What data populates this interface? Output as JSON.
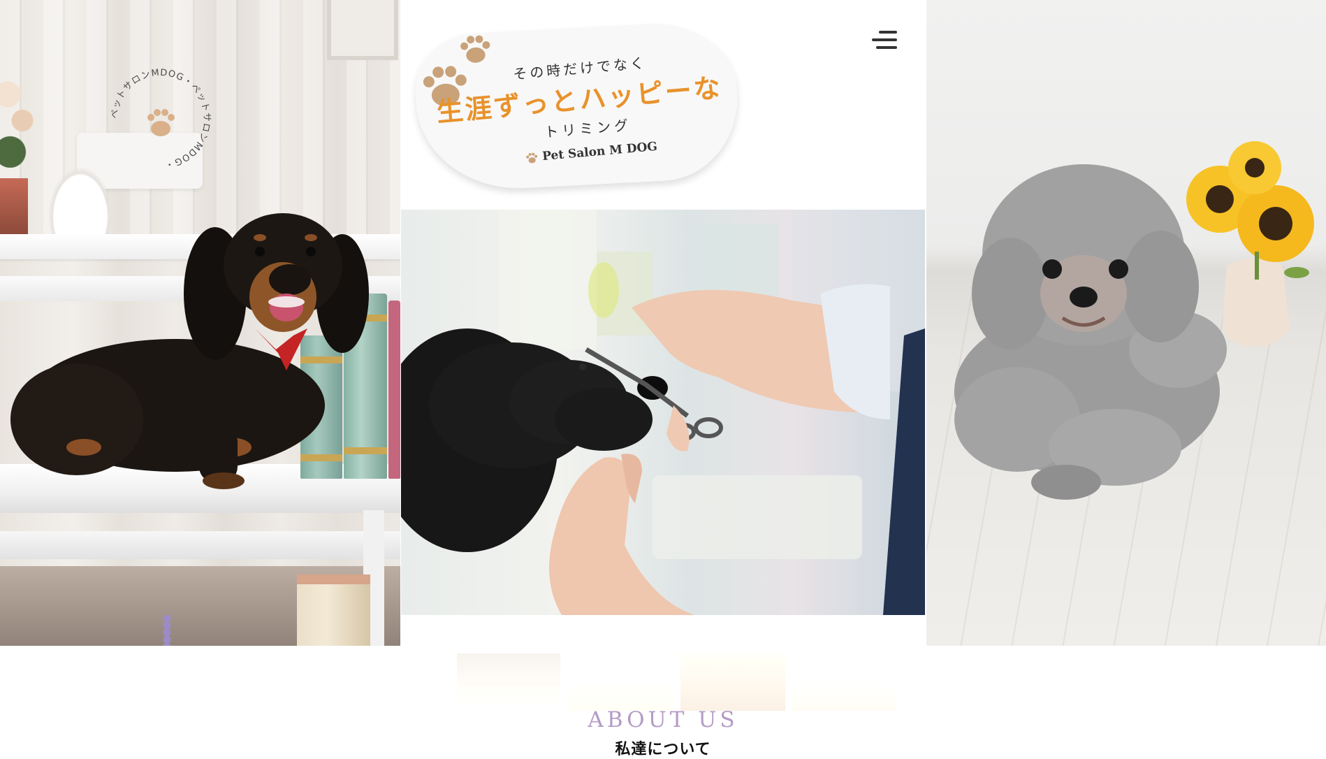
{
  "logo": {
    "tagline_top": "その時だけでなく",
    "tagline_main": "生涯ずっとハッピーな",
    "tagline_bottom": "トリミング",
    "brand": "Pet Salon M DOG"
  },
  "stamp": {
    "circle_text": "ペットサロンMDOG・ペットサロンMDOG・"
  },
  "about": {
    "title": "ABOUT US",
    "subtitle": "私達について"
  },
  "menu": {
    "icon": "hamburger-menu-icon"
  },
  "colors": {
    "accent_orange": "#e8922b",
    "about_title": "#b49bc6",
    "paw": "#c9a27a"
  }
}
